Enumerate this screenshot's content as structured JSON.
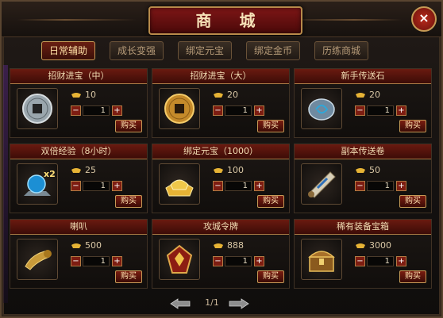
{
  "window": {
    "title": "商 城",
    "close_label": "×"
  },
  "tabs": [
    {
      "label": "日常辅助",
      "active": true
    },
    {
      "label": "成长变强",
      "active": false
    },
    {
      "label": "绑定元宝",
      "active": false
    },
    {
      "label": "绑定金币",
      "active": false
    },
    {
      "label": "历练商城",
      "active": false
    }
  ],
  "items": [
    {
      "name": "招财进宝（中）",
      "price": "10",
      "quantity": "1",
      "buy_label": "购买",
      "icon": "coin-icon"
    },
    {
      "name": "招财进宝（大）",
      "price": "20",
      "quantity": "1",
      "buy_label": "购买",
      "icon": "gold-coin-icon"
    },
    {
      "name": "新手传送石",
      "price": "20",
      "quantity": "1",
      "buy_label": "购买",
      "icon": "teleport-stone-icon"
    },
    {
      "name": "双倍经验（8小时）",
      "price": "25",
      "quantity": "1",
      "buy_label": "购买",
      "icon": "exp-orb-icon",
      "badge": "x2"
    },
    {
      "name": "绑定元宝（1000）",
      "price": "100",
      "quantity": "1",
      "buy_label": "购买",
      "icon": "ingot-pile-icon"
    },
    {
      "name": "副本传送卷",
      "price": "50",
      "quantity": "1",
      "buy_label": "购买",
      "icon": "scroll-icon"
    },
    {
      "name": "喇叭",
      "price": "500",
      "quantity": "1",
      "buy_label": "购买",
      "icon": "horn-icon"
    },
    {
      "name": "攻城令牌",
      "price": "888",
      "quantity": "1",
      "buy_label": "购买",
      "icon": "token-icon"
    },
    {
      "name": "稀有装备宝箱",
      "price": "3000",
      "quantity": "1",
      "buy_label": "购买",
      "icon": "treasure-chest-icon"
    }
  ],
  "pager": {
    "current": "1/1"
  },
  "colors": {
    "accent_red": "#6a1a10",
    "gold_border": "#c69a56"
  }
}
